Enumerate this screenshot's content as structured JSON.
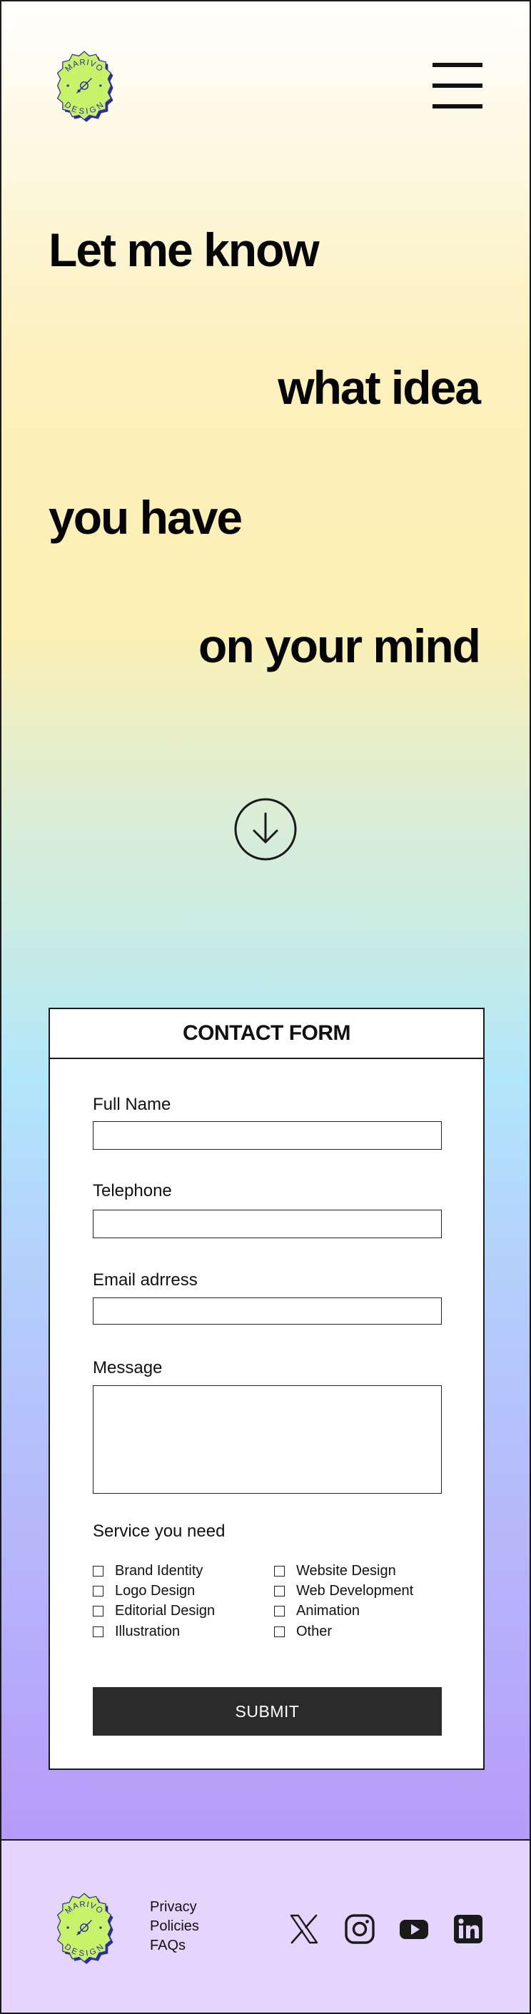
{
  "colors": {
    "logo_fill": "#c8f26a",
    "logo_shadow": "#2b2e9e",
    "submit_bg": "#2b2b2b",
    "footer_bg": "#e5d4fb"
  },
  "logo": {
    "text_top": "MARIVO",
    "text_bottom": "DESIGN"
  },
  "nav": {
    "menu_icon": "hamburger-menu-icon"
  },
  "hero": {
    "line1": "Let me know",
    "line2": "what idea",
    "line3": "you have",
    "line4": "on your mind",
    "scroll_icon": "arrow-down-circle-icon"
  },
  "form": {
    "title": "CONTACT FORM",
    "fields": {
      "full_name": {
        "label": "Full Name",
        "value": ""
      },
      "telephone": {
        "label": "Telephone",
        "value": ""
      },
      "email": {
        "label": "Email adrress",
        "value": ""
      },
      "message": {
        "label": "Message",
        "value": ""
      }
    },
    "services": {
      "label": "Service you need",
      "options": [
        "Brand Identity",
        "Logo Design",
        "Editorial Design",
        "Illustration",
        "Website Design",
        "Web Development",
        "Animation",
        "Other"
      ]
    },
    "submit_label": "SUBMIT"
  },
  "footer": {
    "links": [
      "Privacy",
      "Policies",
      "FAQs"
    ],
    "social_icons": [
      "x-icon",
      "instagram-icon",
      "youtube-icon",
      "linkedin-icon"
    ]
  }
}
